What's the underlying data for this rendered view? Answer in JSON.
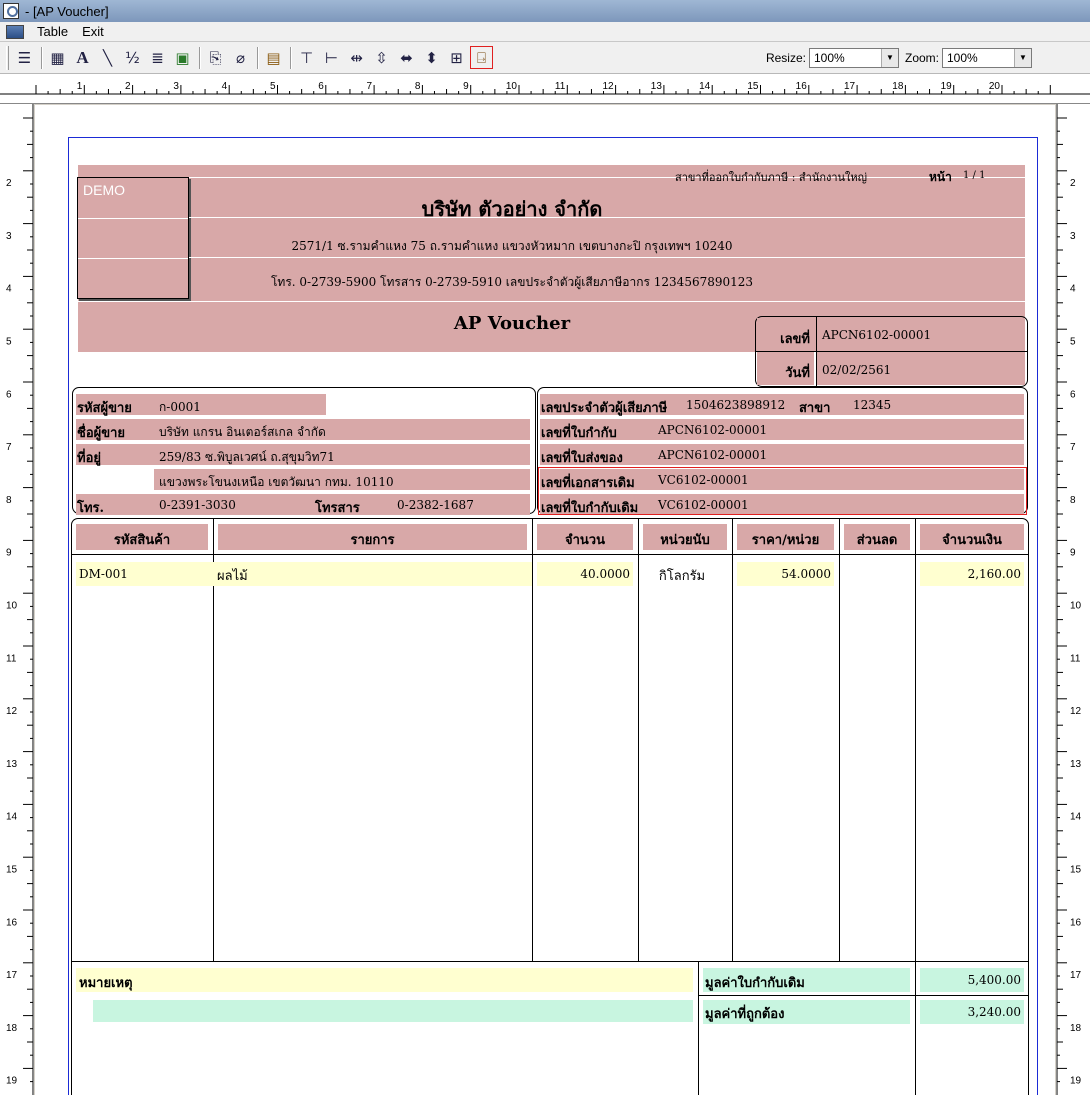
{
  "window": {
    "title": "- [AP Voucher]"
  },
  "menu": {
    "items": [
      "Table",
      "Exit"
    ]
  },
  "toolbar": {
    "resize_label": "Resize:",
    "resize_value": "100%",
    "zoom_label": "Zoom:",
    "zoom_value": "100%"
  },
  "ruler": {
    "top": [
      "1",
      "2",
      "3",
      "4",
      "5",
      "6",
      "7",
      "8",
      "9",
      "10",
      "11",
      "12",
      "13",
      "14",
      "15",
      "16",
      "17",
      "18",
      "19",
      "20"
    ],
    "side": [
      "2",
      "3",
      "4",
      "5",
      "6",
      "7",
      "8",
      "9",
      "10",
      "11",
      "12",
      "13",
      "14",
      "15",
      "16",
      "17",
      "18",
      "19"
    ]
  },
  "doc": {
    "demo": "DEMO",
    "branch": "สาขาที่ออกใบกำกับภาษี : สำนักงานใหญ่",
    "page_label": "หน้า",
    "page_value": "1 / 1",
    "company": "บริษัท ตัวอย่าง จำกัด",
    "address": "2571/1 ซ.รามคำแหง 75 ถ.รามคำแหง แขวงหัวหมาก เขตบางกะปิ กรุงเทพฯ 10240",
    "contact": "โทร. 0-2739-5900  โทรสาร 0-2739-5910  เลขประจำตัวผู้เสียภาษีอากร 1234567890123",
    "doc_title": "AP Voucher",
    "no_label": "เลขที่",
    "no_value": "APCN6102-00001",
    "date_label": "วันที่",
    "date_value": "02/02/2561",
    "vendor": {
      "code_label": "รหัสผู้ขาย",
      "code": "ก-0001",
      "name_label": "ชื่อผู้ขาย",
      "name": "บริษัท แกรน อินเตอร์สเกล จำกัด",
      "addr_label": "ที่อยู่",
      "addr1": "259/83 ซ.พิบูลเวศน์ ถ.สุขุมวิท71",
      "addr2": "แขวงพระโขนงเหนือ เขตวัฒนา กทม. 10110",
      "tel_label": "โทร.",
      "tel": "0-2391-3030",
      "fax_label": "โทรสาร",
      "fax": "0-2382-1687"
    },
    "refs": {
      "tax_label": "เลขประจำตัวผู้เสียภาษี",
      "tax": "1504623898912",
      "branch_label": "สาขา",
      "branch": "12345",
      "inv_label": "เลขที่ใบกำกับ",
      "inv": "APCN6102-00001",
      "dlv_label": "เลขที่ใบส่งของ",
      "dlv": "APCN6102-00001",
      "orig_doc_label": "เลขที่เอกสารเดิม",
      "orig_doc": "VC6102-00001",
      "orig_inv_label": "เลขที่ใบกำกับเดิม",
      "orig_inv": "VC6102-00001"
    },
    "table": {
      "headers": [
        "รหัสสินค้า",
        "รายการ",
        "จำนวน",
        "หน่วยนับ",
        "ราคา/หน่วย",
        "ส่วนลด",
        "จำนวนเงิน"
      ],
      "rows": [
        {
          "code": "DM-001",
          "desc": "ผลไม้",
          "qty": "40.0000",
          "unit": "กิโลกรัม",
          "price": "54.0000",
          "discount": "",
          "amount": "2,160.00"
        }
      ]
    },
    "footer": {
      "remark_label": "หมายเหตุ",
      "orig_value_label": "มูลค่าใบกำกับเดิม",
      "orig_value": "5,400.00",
      "correct_value_label": "มูลค่าที่ถูกต้อง",
      "correct_value": "3,240.00"
    }
  },
  "colors": {
    "pink": "#d8a8a8",
    "yellow": "#ffffd0",
    "green": "#c8f5e0",
    "frame": "#1b2bd6",
    "highlight": "#e02020"
  }
}
